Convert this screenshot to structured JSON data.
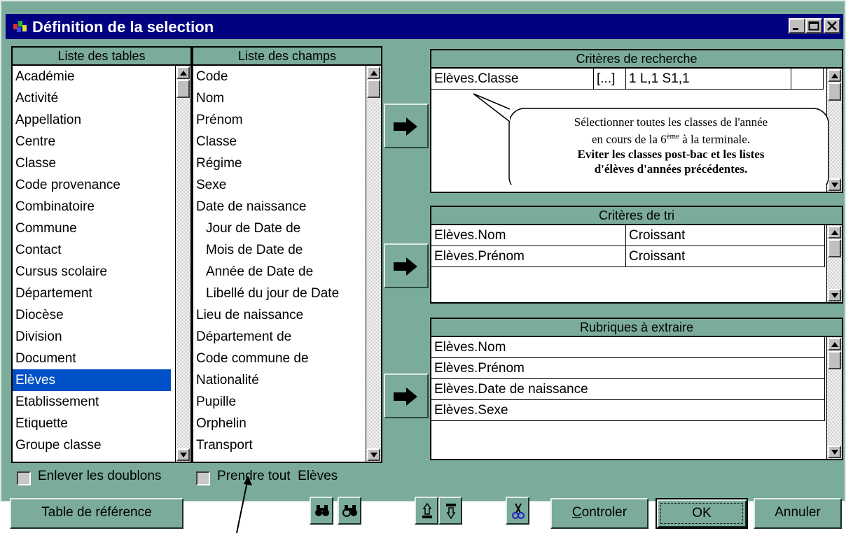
{
  "window": {
    "title": "Définition de la selection",
    "bg_color": "#7aab9b",
    "titlebar_color": "#000080"
  },
  "tables_panel": {
    "header": "Liste des tables",
    "items": [
      "Académie",
      "Activité",
      "Appellation",
      "Centre",
      "Classe",
      "Code provenance",
      "Combinatoire",
      "Commune",
      "Contact",
      "Cursus scolaire",
      "Département",
      "Diocèse",
      "Division",
      "Document",
      "Elèves",
      "Etablissement",
      "Etiquette",
      "Groupe classe"
    ],
    "selected": "Elèves"
  },
  "fields_panel": {
    "header": "Liste des champs",
    "items": [
      {
        "label": "Code",
        "indent": false
      },
      {
        "label": "Nom",
        "indent": false
      },
      {
        "label": "Prénom",
        "indent": false
      },
      {
        "label": "Classe",
        "indent": false
      },
      {
        "label": "Régime",
        "indent": false
      },
      {
        "label": "Sexe",
        "indent": false
      },
      {
        "label": "Date de naissance",
        "indent": false
      },
      {
        "label": "Jour de Date de",
        "indent": true
      },
      {
        "label": "Mois de Date de",
        "indent": true
      },
      {
        "label": "Année de Date de",
        "indent": true
      },
      {
        "label": "Libellé du jour de Date",
        "indent": true
      },
      {
        "label": "Lieu de naissance",
        "indent": false
      },
      {
        "label": "Département de",
        "indent": false
      },
      {
        "label": "Code commune de",
        "indent": false
      },
      {
        "label": "Nationalité",
        "indent": false
      },
      {
        "label": "Pupille",
        "indent": false
      },
      {
        "label": "Orphelin",
        "indent": false
      },
      {
        "label": "Transport",
        "indent": false
      }
    ]
  },
  "search_criteria": {
    "header": "Critères de recherche",
    "rows": [
      {
        "field": "Elèves.Classe",
        "op": "[...]",
        "value": "1 L,1 S1,1"
      }
    ]
  },
  "callout": {
    "line1": "Sélectionner toutes les classes de l'année",
    "line2a": "en cours de la 6",
    "line2sup": "ème",
    "line2b": " à la terminale.",
    "line3": "Eviter les classes post-bac et les listes",
    "line4": "d'élèves d'années précédentes."
  },
  "sort_criteria": {
    "header": "Critères de tri",
    "rows": [
      {
        "field": "Elèves.Nom",
        "order": "Croissant"
      },
      {
        "field": "Elèves.Prénom",
        "order": "Croissant"
      }
    ]
  },
  "extract_fields": {
    "header": "Rubriques à extraire",
    "rows": [
      "Elèves.Nom",
      "Elèves.Prénom",
      "Elèves.Date de naissance",
      "Elèves.Sexe"
    ]
  },
  "options": {
    "remove_duplicates": "Enlever les doublons",
    "take_all": "Prendre tout",
    "take_all_table": "Elèves"
  },
  "buttons": {
    "reference_table": "Table de référence",
    "control_first": "C",
    "control_rest": "ontroler",
    "ok": "OK",
    "cancel": "Annuler"
  }
}
